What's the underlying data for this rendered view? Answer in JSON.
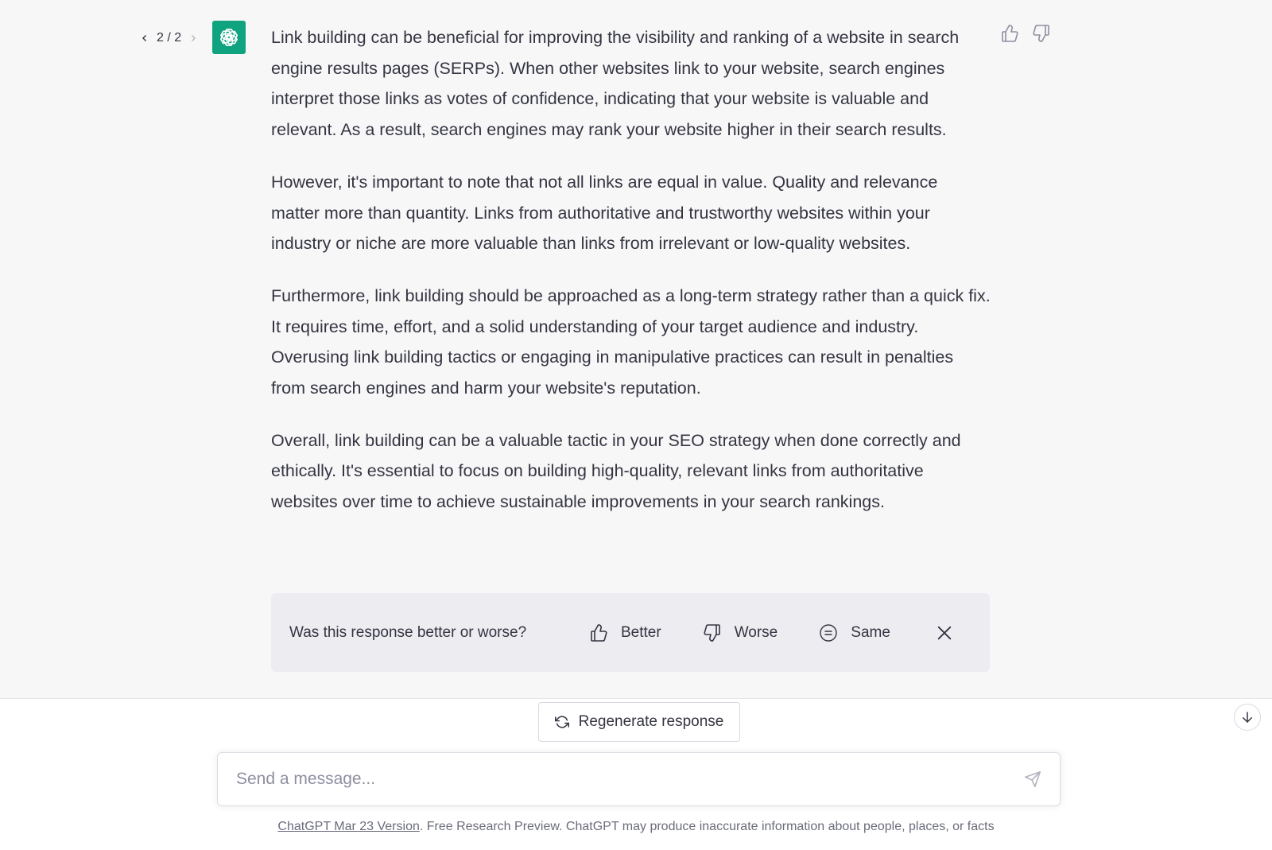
{
  "pager": {
    "current": "2 / 2"
  },
  "message": {
    "paragraphs": [
      "Link building can be beneficial for improving the visibility and ranking of a website in search engine results pages (SERPs). When other websites link to your website, search engines interpret those links as votes of confidence, indicating that your website is valuable and relevant. As a result, search engines may rank your website higher in their search results.",
      "However, it's important to note that not all links are equal in value. Quality and relevance matter more than quantity. Links from authoritative and trustworthy websites within your industry or niche are more valuable than links from irrelevant or low-quality websites.",
      "Furthermore, link building should be approached as a long-term strategy rather than a quick fix. It requires time, effort, and a solid understanding of your target audience and industry. Overusing link building tactics or engaging in manipulative practices can result in penalties from search engines and harm your website's reputation.",
      "Overall, link building can be a valuable tactic in your SEO strategy when done correctly and ethically. It's essential to focus on building high-quality, relevant links from authoritative websites over time to achieve sustainable improvements in your search rankings."
    ]
  },
  "compare": {
    "question": "Was this response better or worse?",
    "better_label": "Better",
    "worse_label": "Worse",
    "same_label": "Same"
  },
  "regenerate": {
    "label": "Regenerate response"
  },
  "composer": {
    "placeholder": "Send a message..."
  },
  "footer": {
    "version_link": "ChatGPT Mar 23 Version",
    "notice": ". Free Research Preview. ChatGPT may produce inaccurate information about people, places, or facts"
  },
  "colors": {
    "brand": "#10a37f",
    "chat_bg": "#f7f7f8",
    "compare_bg": "#ececf1",
    "text": "#343541"
  },
  "icons": [
    "chevron-left-icon",
    "chevron-right-icon",
    "openai-logo-icon",
    "thumbs-up-icon",
    "thumbs-down-icon",
    "equals-circle-icon",
    "close-icon",
    "refresh-icon",
    "arrow-down-icon",
    "send-icon"
  ]
}
